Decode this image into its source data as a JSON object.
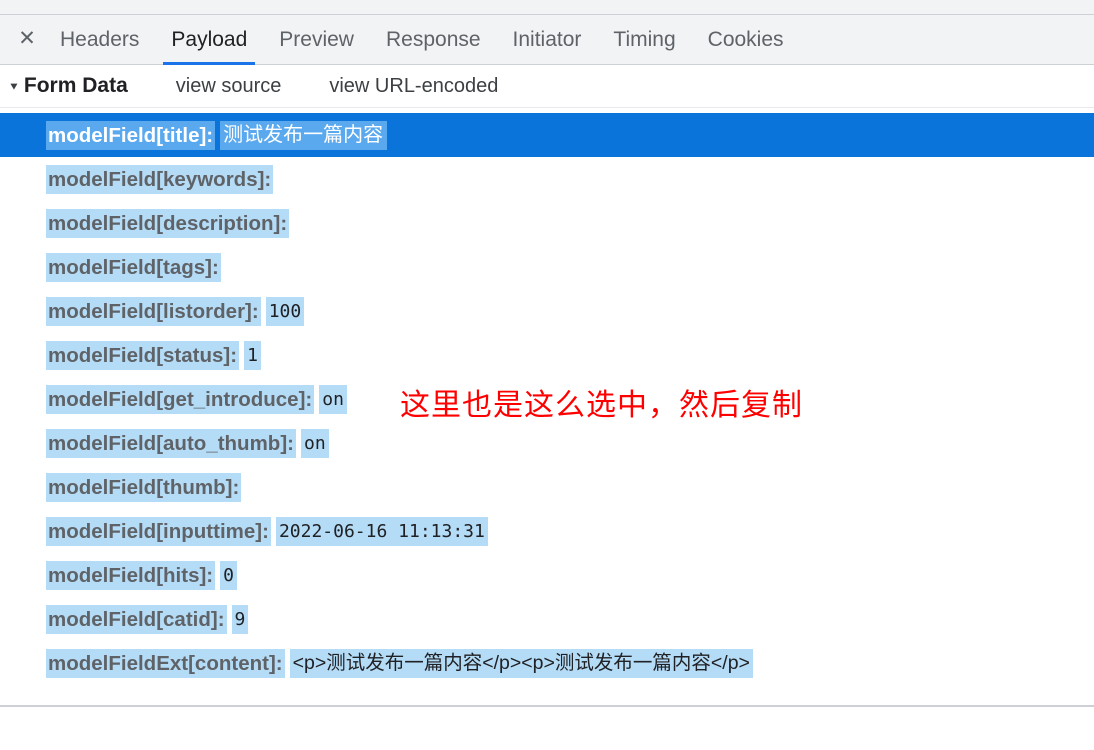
{
  "devtools": {
    "close_icon_label": "✕",
    "tabs": [
      {
        "label": "Headers",
        "active": false
      },
      {
        "label": "Payload",
        "active": true
      },
      {
        "label": "Preview",
        "active": false
      },
      {
        "label": "Response",
        "active": false
      },
      {
        "label": "Initiator",
        "active": false
      },
      {
        "label": "Timing",
        "active": false
      },
      {
        "label": "Cookies",
        "active": false
      }
    ],
    "accent_color": "#1a73e8"
  },
  "form_data": {
    "disclosure_glyph": "▼",
    "section_title": "Form Data",
    "view_source_label": "view source",
    "view_url_encoded_label": "view URL-encoded",
    "selection_color": "#0a74db",
    "highlight_color": "#b5dcf7",
    "selected_highlight_color": "#5aa9ef",
    "rows": [
      {
        "key": "modelField[title]:",
        "value": "测试发布一篇内容",
        "selected": true,
        "cjk": true
      },
      {
        "key": "modelField[keywords]:",
        "value": "",
        "selected": false,
        "cjk": false
      },
      {
        "key": "modelField[description]:",
        "value": "",
        "selected": false,
        "cjk": false
      },
      {
        "key": "modelField[tags]:",
        "value": "",
        "selected": false,
        "cjk": false
      },
      {
        "key": "modelField[listorder]:",
        "value": "100",
        "selected": false,
        "cjk": false
      },
      {
        "key": "modelField[status]:",
        "value": "1",
        "selected": false,
        "cjk": false
      },
      {
        "key": "modelField[get_introduce]:",
        "value": "on",
        "selected": false,
        "cjk": false
      },
      {
        "key": "modelField[auto_thumb]:",
        "value": "on",
        "selected": false,
        "cjk": false
      },
      {
        "key": "modelField[thumb]:",
        "value": "",
        "selected": false,
        "cjk": false
      },
      {
        "key": "modelField[inputtime]:",
        "value": "2022-06-16 11:13:31",
        "selected": false,
        "cjk": false
      },
      {
        "key": "modelField[hits]:",
        "value": "0",
        "selected": false,
        "cjk": false
      },
      {
        "key": "modelField[catid]:",
        "value": "9",
        "selected": false,
        "cjk": false
      },
      {
        "key": "modelFieldExt[content]:",
        "value": "<p>测试发布一篇内容</p><p>测试发布一篇内容</p>",
        "selected": false,
        "cjk": true
      }
    ]
  },
  "annotation": {
    "text": "这里也是这么选中，然后复制",
    "color": "#ff0000"
  }
}
